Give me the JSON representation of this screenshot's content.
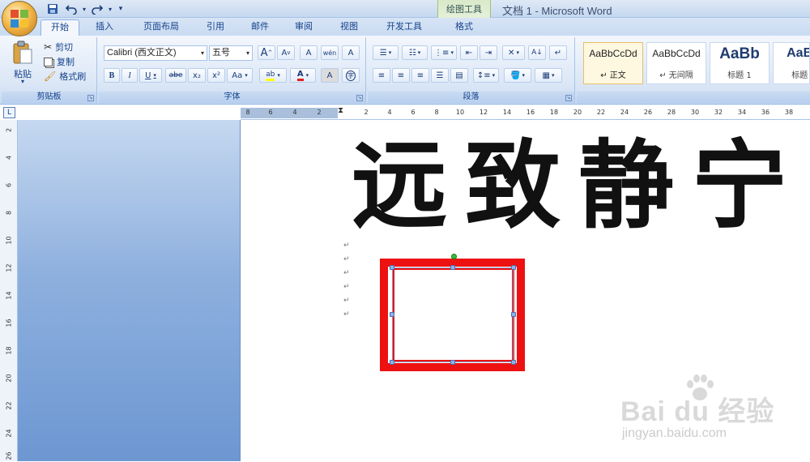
{
  "title_bar": {
    "window_title": "文档 1 - Microsoft Word",
    "context_tool_group": "绘图工具",
    "qat": [
      "save-icon",
      "undo-icon",
      "redo-icon",
      "customize-qat-icon"
    ]
  },
  "tabs": [
    {
      "label": "开始",
      "active": true
    },
    {
      "label": "插入"
    },
    {
      "label": "页面布局"
    },
    {
      "label": "引用"
    },
    {
      "label": "邮件"
    },
    {
      "label": "审阅"
    },
    {
      "label": "视图"
    },
    {
      "label": "开发工具"
    },
    {
      "label": "格式"
    }
  ],
  "ribbon": {
    "clipboard": {
      "group_label": "剪贴板",
      "paste": "粘贴",
      "cut": "剪切",
      "copy": "复制",
      "format_painter": "格式刷"
    },
    "font": {
      "group_label": "字体",
      "font_name": "Calibri (西文正文)",
      "font_size": "五号",
      "bold": "B",
      "italic": "I",
      "underline": "U",
      "strikethrough": "abe",
      "subscript": "x₂",
      "superscript": "x²",
      "change_case": "Aa",
      "grow_font": "A",
      "shrink_font": "A",
      "clear_format": "A",
      "phonetic": "wén",
      "char_border": "A",
      "font_color": "A",
      "char_shading": "A",
      "enclose_char": "字"
    },
    "paragraph": {
      "group_label": "段落"
    },
    "styles": {
      "items": [
        {
          "sample": "AaBbCcDd",
          "name": "↵ 正文"
        },
        {
          "sample": "AaBbCcDd",
          "name": "↵ 无间隔"
        },
        {
          "sample": "AaBb",
          "name": "标题 1"
        },
        {
          "sample": "AaBb",
          "name": "标题 2"
        }
      ]
    }
  },
  "ruler": {
    "corner": "L",
    "h_left": [
      "8",
      "6",
      "4",
      "2"
    ],
    "h_right": [
      "2",
      "4",
      "6",
      "8",
      "10",
      "12",
      "14",
      "16",
      "18",
      "20",
      "22",
      "24",
      "26",
      "28",
      "30",
      "32",
      "34",
      "36",
      "38"
    ],
    "v_numbers": [
      "2",
      "4",
      "6",
      "8",
      "10",
      "12",
      "14",
      "16",
      "18",
      "20",
      "22",
      "24",
      "26"
    ]
  },
  "document": {
    "calligraphy_text": "远致静宁",
    "paragraph_mark": "↵"
  },
  "watermark": {
    "brand": "Bai du 经验",
    "url": "jingyan.baidu.com"
  },
  "colors": {
    "frame_red": "#ee1111",
    "ribbon_bg": "#dbe7f6",
    "nav_pane": "#8eb0de"
  }
}
